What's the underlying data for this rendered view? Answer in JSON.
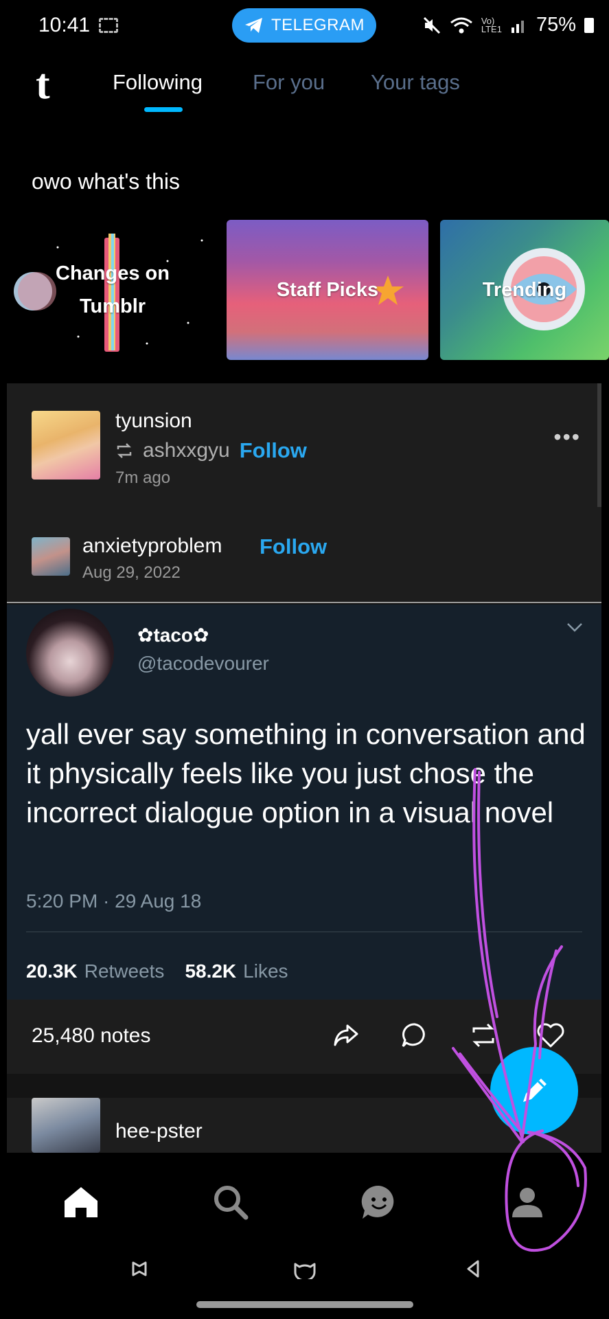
{
  "status_bar": {
    "time": "10:41",
    "notification_app": "TELEGRAM",
    "volte": "Vo)",
    "lte": "LTE1",
    "battery": "75%"
  },
  "top_nav": {
    "logo": "t",
    "tabs": [
      {
        "label": "Following",
        "active": true
      },
      {
        "label": "For you",
        "active": false
      },
      {
        "label": "Your tags",
        "active": false
      }
    ]
  },
  "section": {
    "title": "owo what's this"
  },
  "carousel": [
    {
      "label": "Changes on Tumblr"
    },
    {
      "label": "Staff Picks"
    },
    {
      "label": "Trending"
    }
  ],
  "post": {
    "username": "tyunsion",
    "reblogged_from": "ashxxgyu",
    "follow_label": "Follow",
    "time_ago": "7m ago",
    "more_label": "•••",
    "source": {
      "username": "anxietyproblem",
      "follow_label": "Follow",
      "date": "Aug 29, 2022"
    },
    "tweet": {
      "display_name": "✿taco✿",
      "handle": "@tacodevourer",
      "text": "yall ever say something in conversation and it physically feels like you just chose the incorrect dialogue option in a visual novel",
      "timestamp": "5:20 PM · 29 Aug 18",
      "retweets_count": "20.3K",
      "retweets_label": "Retweets",
      "likes_count": "58.2K",
      "likes_label": "Likes"
    },
    "notes": "25,480 notes"
  },
  "next_post": {
    "username": "hee-pster"
  },
  "colors": {
    "accent": "#00b8ff",
    "follow": "#2aa8f0",
    "tweet_bg": "#15202b",
    "annotation": "#c050e0"
  },
  "icons": {
    "bottom_nav": [
      "home-icon",
      "search-icon",
      "chat-icon",
      "account-icon"
    ],
    "post_actions": [
      "share-icon",
      "reply-icon",
      "reblog-icon",
      "like-icon"
    ],
    "fab": "compose-pencil-icon"
  }
}
